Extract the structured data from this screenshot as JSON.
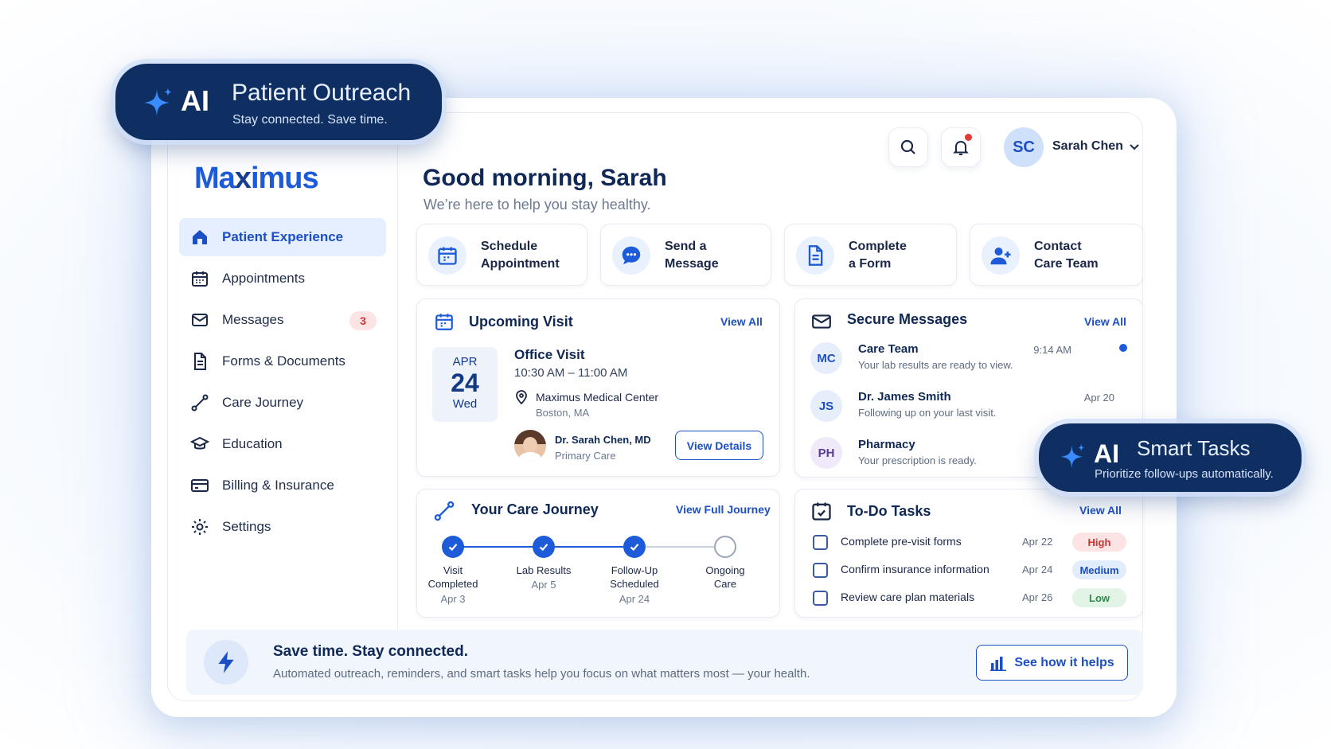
{
  "brand": {
    "logo_pre": "Ma",
    "logo_x": "x",
    "logo_post": "imus"
  },
  "ai_outreach": {
    "ai": "AI",
    "title": "Patient Outreach",
    "subtitle": "Stay connected. Save time."
  },
  "ai_tasks": {
    "ai": "AI",
    "title": "Smart Tasks",
    "subtitle": "Prioritize follow-ups automatically."
  },
  "sidebar": {
    "items": [
      {
        "label": "Patient Experience",
        "icon": "home-icon"
      },
      {
        "label": "Appointments",
        "icon": "calendar-icon"
      },
      {
        "label": "Messages",
        "icon": "mail-icon",
        "badge": "3"
      },
      {
        "label": "Forms & Documents",
        "icon": "document-icon"
      },
      {
        "label": "Care Journey",
        "icon": "route-icon"
      },
      {
        "label": "Education",
        "icon": "graduation-cap-icon"
      },
      {
        "label": "Billing & Insurance",
        "icon": "credit-card-icon"
      },
      {
        "label": "Settings",
        "icon": "gear-icon"
      }
    ]
  },
  "header": {
    "user_initials": "SC",
    "user_name": "Sarah Chen"
  },
  "greeting": {
    "title": "Good morning, Sarah",
    "subtitle": "We’re here to help you stay healthy."
  },
  "quick_actions": [
    {
      "label": "Schedule\nAppointment",
      "icon": "calendar-icon"
    },
    {
      "label": "Send a\nMessage",
      "icon": "chat-icon"
    },
    {
      "label": "Complete\na Form",
      "icon": "document-icon"
    },
    {
      "label": "Contact\nCare Team",
      "icon": "user-plus-icon"
    }
  ],
  "upcoming_visit": {
    "title": "Upcoming Visit",
    "view_all": "View All",
    "month": "APR",
    "day": "24",
    "weekday": "Wed",
    "visit_type": "Office Visit",
    "time": "10:30 AM – 11:00 AM",
    "location": "Maximus Medical Center",
    "city": "Boston, MA",
    "doctor": "Dr. Sarah Chen, MD",
    "specialty": "Primary Care",
    "details_button": "View Details"
  },
  "secure_messages": {
    "title": "Secure Messages",
    "view_all": "View All",
    "items": [
      {
        "initials": "MC",
        "from": "Care Team",
        "preview": "Your lab results are ready to view.",
        "time": "9:14 AM"
      },
      {
        "initials": "JS",
        "from": "Dr. James Smith",
        "preview": "Following up on your last visit.",
        "time": "Apr 20"
      },
      {
        "initials": "PH",
        "from": "Pharmacy",
        "preview": "Your prescription is ready.",
        "time": ""
      }
    ]
  },
  "care_journey": {
    "title": "Your Care Journey",
    "view_all": "View Full Journey",
    "steps": [
      {
        "label": "Visit\nCompleted",
        "date": "Apr 3",
        "done": true
      },
      {
        "label": "Lab Results",
        "date": "Apr 5",
        "done": true
      },
      {
        "label": "Follow-Up\nScheduled",
        "date": "Apr 24",
        "done": true
      },
      {
        "label": "Ongoing\nCare",
        "date": "",
        "done": false
      }
    ]
  },
  "todo": {
    "title": "To-Do Tasks",
    "view_all": "View All",
    "items": [
      {
        "task": "Complete pre-visit forms",
        "date": "Apr 22",
        "priority": "High"
      },
      {
        "task": "Confirm insurance information",
        "date": "Apr 24",
        "priority": "Medium"
      },
      {
        "task": "Review care plan materials",
        "date": "Apr 26",
        "priority": "Low"
      }
    ]
  },
  "banner": {
    "title": "Save time. Stay connected.",
    "text": "Automated outreach, reminders, and smart tasks help you focus on what matters most — your health.",
    "button": "See how it helps"
  },
  "colors": {
    "primary": "#1d5bd8",
    "navy": "#0f2f63",
    "high": "#d33030",
    "medium": "#1d4fc4",
    "low": "#2e8b4a"
  }
}
